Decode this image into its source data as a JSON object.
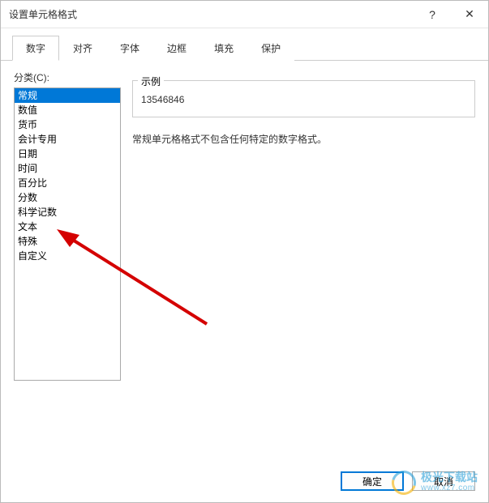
{
  "window": {
    "title": "设置单元格格式",
    "help_glyph": "?",
    "close_glyph": "✕"
  },
  "tabs": [
    {
      "label": "数字",
      "active": true
    },
    {
      "label": "对齐",
      "active": false
    },
    {
      "label": "字体",
      "active": false
    },
    {
      "label": "边框",
      "active": false
    },
    {
      "label": "填充",
      "active": false
    },
    {
      "label": "保护",
      "active": false
    }
  ],
  "category": {
    "label": "分类(C):",
    "items": [
      "常规",
      "数值",
      "货币",
      "会计专用",
      "日期",
      "时间",
      "百分比",
      "分数",
      "科学记数",
      "文本",
      "特殊",
      "自定义"
    ],
    "selected_index": 0
  },
  "sample": {
    "label": "示例",
    "value": "13546846"
  },
  "description": "常规单元格格式不包含任何特定的数字格式。",
  "buttons": {
    "ok": "确定",
    "cancel": "取消"
  },
  "watermark": {
    "cn": "极光下载站",
    "en": "www.xz7.com"
  }
}
